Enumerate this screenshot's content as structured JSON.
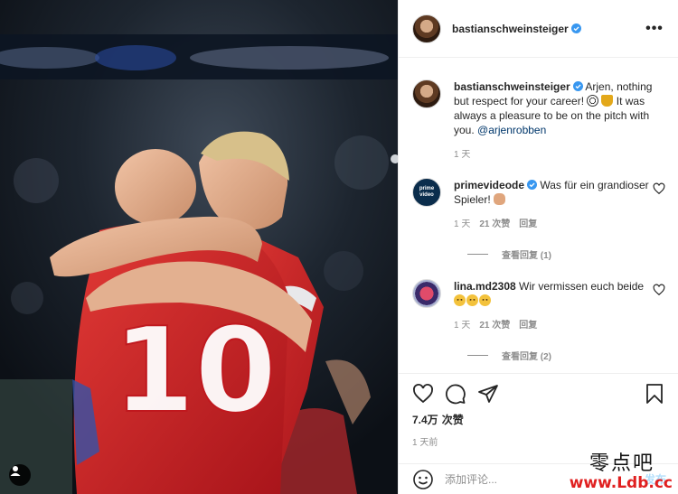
{
  "post": {
    "photo": {
      "subject": "two footballers in red embracing",
      "jersey_number": "10",
      "user_tag_icon": "user-tag-icon"
    }
  },
  "header": {
    "username": "bastianschweinsteiger",
    "verified": true,
    "more_icon": "more-icon"
  },
  "caption": {
    "username": "bastianschweinsteiger",
    "text_1": "Arjen, nothing but respect for your career!",
    "text_2": "It was always a pleasure to be on the pitch with you.",
    "mention": "@arjenrobben",
    "time": "1 天"
  },
  "comments": [
    {
      "username": "primevideode",
      "avatar_text": [
        "prime",
        "video"
      ],
      "verified": true,
      "text": "Was für ein grandioser Spieler!",
      "time": "1 天",
      "likes": "21 次赞",
      "reply": "回复",
      "view_replies": "查看回复 (1)"
    },
    {
      "username": "lina.md2308",
      "verified": false,
      "text": "Wir vermissen euch beide",
      "time": "1 天",
      "likes": "21 次赞",
      "reply": "回复",
      "view_replies": "查看回复 (2)"
    }
  ],
  "actions": {
    "like_count": "7.4万",
    "like_suffix": "次赞",
    "time_ago": "1 天前"
  },
  "add_comment": {
    "placeholder": "添加评论...",
    "post_label": "发布"
  },
  "watermark": {
    "chinese": "零点吧",
    "url": "www.Ldb.cc"
  },
  "colors": {
    "verified": "#3897f0",
    "mention": "#00376b",
    "meta": "#8e8e8e",
    "post_disabled": "#b2dffc",
    "watermark_url": "#e02020"
  }
}
